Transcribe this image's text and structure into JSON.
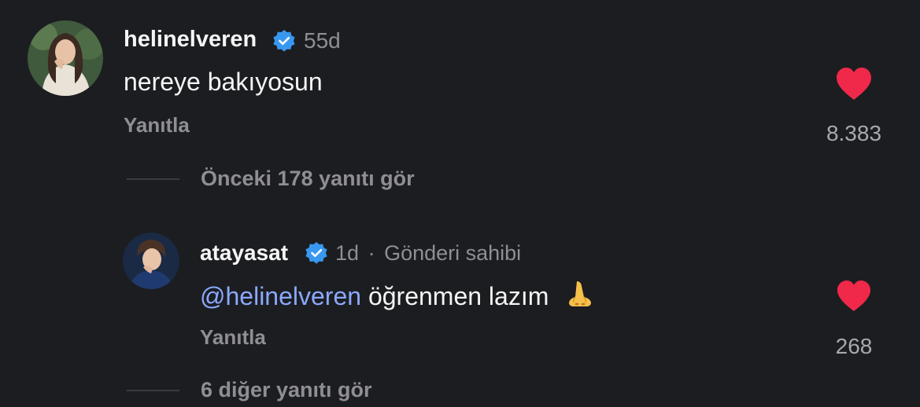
{
  "comment1": {
    "username": "helinelveren",
    "time": "55d",
    "text": "nereye bakıyosun",
    "reply_label": "Yanıtla",
    "likes": "8.383",
    "verified": true
  },
  "view_previous": {
    "label": "Önceki 178 yanıtı gör"
  },
  "comment2": {
    "username": "atayasat",
    "time": "1d",
    "separator": "·",
    "author_tag": "Gönderi sahibi",
    "mention": "@helinelveren",
    "text": "öğrenmen lazım",
    "emoji": "nose-emoji",
    "reply_label": "Yanıtla",
    "likes": "268",
    "verified": true
  },
  "view_more": {
    "label": "6 diğer yanıtı gör"
  },
  "colors": {
    "background": "#1c1d21",
    "heart": "#f02849",
    "verified": "#3897f0",
    "mention": "#8aa8ff",
    "muted": "#8e8e93"
  }
}
